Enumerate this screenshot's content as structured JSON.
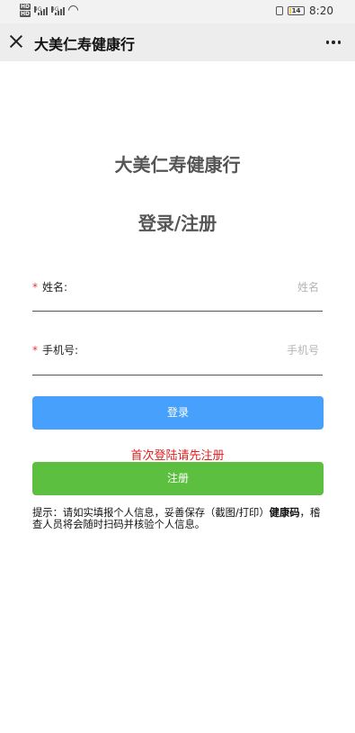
{
  "status_bar": {
    "network_badge_1": "HD",
    "network_badge_2": "HD",
    "signal_1_label": "4G",
    "signal_2_label": "4G",
    "battery": "14",
    "time": "8:20"
  },
  "navbar": {
    "title": "大美仁寿健康行"
  },
  "page": {
    "app_title": "大美仁寿健康行",
    "subtitle": "登录/注册"
  },
  "form": {
    "required_mark": "*",
    "name_label": "姓名:",
    "name_placeholder": "姓名",
    "name_value": "",
    "phone_label": "手机号:",
    "phone_placeholder": "手机号",
    "phone_value": ""
  },
  "buttons": {
    "login": "登录",
    "register": "注册"
  },
  "first_login_hint": "首次登陆请先注册",
  "notice": {
    "prefix": "提示：请如实填报个人信息，妥善保存（截图/打印）",
    "highlight": "健康码",
    "suffix": "，稽查人员将会随时扫码并核验个人信息。"
  },
  "colors": {
    "login_button": "#46a0fc",
    "register_button": "#5cbf3f",
    "hint_text": "#e02020",
    "required_mark": "#e53935"
  }
}
